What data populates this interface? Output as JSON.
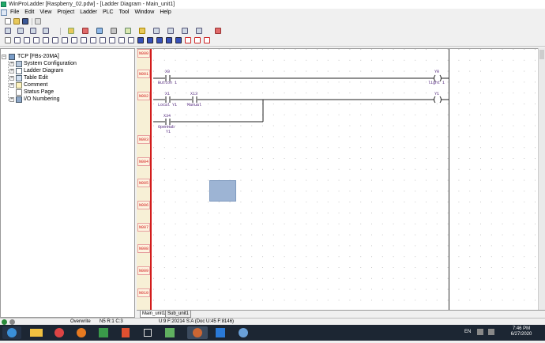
{
  "window": {
    "title": "WinProLadder [Raspberry_02.pdw] - [Ladder Diagram - Main_unit1]"
  },
  "menu": [
    "File",
    "Edit",
    "View",
    "Project",
    "Ladder",
    "PLC",
    "Tool",
    "Window",
    "Help"
  ],
  "project_tree": {
    "root": "TCP [FBs-20MA]",
    "items": [
      {
        "label": "System Configuration",
        "icon": "gear-icon"
      },
      {
        "label": "Ladder Diagram",
        "icon": "ladder-icon"
      },
      {
        "label": "Table Edit",
        "icon": "table-icon"
      },
      {
        "label": "Comment",
        "icon": "comment-icon"
      },
      {
        "label": "Status Page",
        "icon": "page-icon"
      },
      {
        "label": "I/O Numbering",
        "icon": "io-icon"
      }
    ]
  },
  "rungs": [
    "N000",
    "N001",
    "N002",
    "N003",
    "N004",
    "N005",
    "N006",
    "N007",
    "N008",
    "N009",
    "N010"
  ],
  "ladder": {
    "x0_addr": "X0",
    "x0_comment": "Button 1",
    "y0_addr": "Y0",
    "y0_comment": "light 1",
    "x1_addr": "X1",
    "x1_comment": "Local Y1",
    "x13_addr": "X13",
    "x13_comment": "Manual",
    "y1_addr": "Y1",
    "x34_addr": "X34",
    "x34_comment_1": "OpenHab",
    "x34_comment_2": "Y1"
  },
  "tabs": [
    "Main_unit1",
    "Sub_unit1"
  ],
  "status": {
    "mode": "Overwrite",
    "position": "N5 R:1 C:3",
    "info": "U:9 F:20214 S:A (Doc U:45 F:8146)"
  },
  "taskbar": {
    "lang": "EN",
    "time": "7:46 PM",
    "date": "6/27/2020"
  }
}
